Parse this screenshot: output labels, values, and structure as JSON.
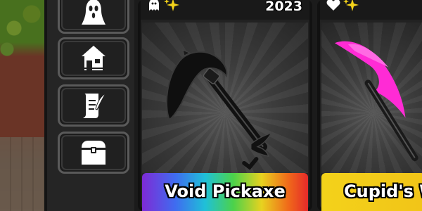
{
  "sidebar": {
    "items": [
      {
        "icon": "ghostface-mask-icon"
      },
      {
        "icon": "house-icon"
      },
      {
        "icon": "scroll-quill-icon"
      },
      {
        "icon": "treasure-chest-icon"
      }
    ]
  },
  "cards": [
    {
      "year": "2023",
      "name": "Void Pickaxe",
      "tag_icons": [
        "ghost-icon",
        "sparkle-icon"
      ],
      "rarity_bar": "rainbow"
    },
    {
      "name": "Cupid's W",
      "tag_icons": [
        "heart-icon",
        "sparkle-icon"
      ],
      "rarity_bar": "#f3d21a"
    }
  ],
  "colors": {
    "panel": "#252525",
    "button_border": "#5a5a5a",
    "legendary_yellow": "#f3d21a",
    "sparkle": "#f3d21a",
    "cupid_pink": "#ff2bd5"
  }
}
